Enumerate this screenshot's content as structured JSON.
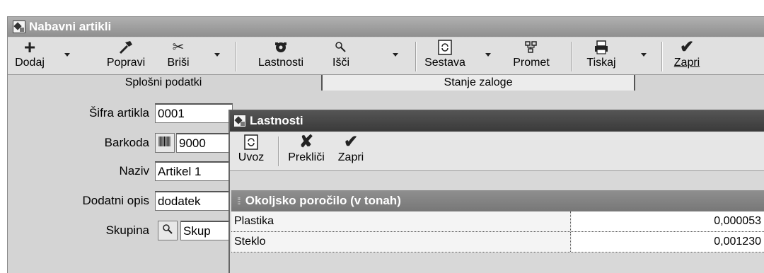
{
  "window": {
    "title": "Nabavni artikli"
  },
  "toolbar": {
    "dodaj": "Dodaj",
    "popravi": "Popravi",
    "brisi": "Briši",
    "lastnosti": "Lastnosti",
    "isci": "Išči",
    "sestava": "Sestava",
    "promet": "Promet",
    "tiskaj": "Tiskaj",
    "zapri": "Zapri"
  },
  "tabs": {
    "splosni": "Splošni podatki",
    "stanje": "Stanje zaloge"
  },
  "form": {
    "sifra_label": "Šifra artikla",
    "sifra_value": "0001",
    "barkoda_label": "Barkoda",
    "barkoda_value": "9000",
    "naziv_label": "Naziv",
    "naziv_value": "Artikel 1",
    "opis_label": "Dodatni opis",
    "opis_value": "dodatek",
    "skupina_label": "Skupina",
    "skupina_value": "Skup"
  },
  "dialog": {
    "title": "Lastnosti",
    "toolbar": {
      "uvoz": "Uvoz",
      "preklici": "Prekliči",
      "zapri": "Zapri"
    },
    "group": "Okoljsko poročilo (v tonah)",
    "rows": [
      {
        "name": "Plastika",
        "value": "0,000053"
      },
      {
        "name": "Steklo",
        "value": "0,001230"
      }
    ]
  },
  "icons": {
    "add": "plus-icon",
    "edit": "hammer-icon",
    "delete": "scissors-icon",
    "properties": "properties-icon",
    "search": "magnifier-icon",
    "composition": "refresh-icon",
    "traffic": "network-icon",
    "print": "printer-icon",
    "close": "checkmark-icon",
    "cancel": "x-icon"
  }
}
